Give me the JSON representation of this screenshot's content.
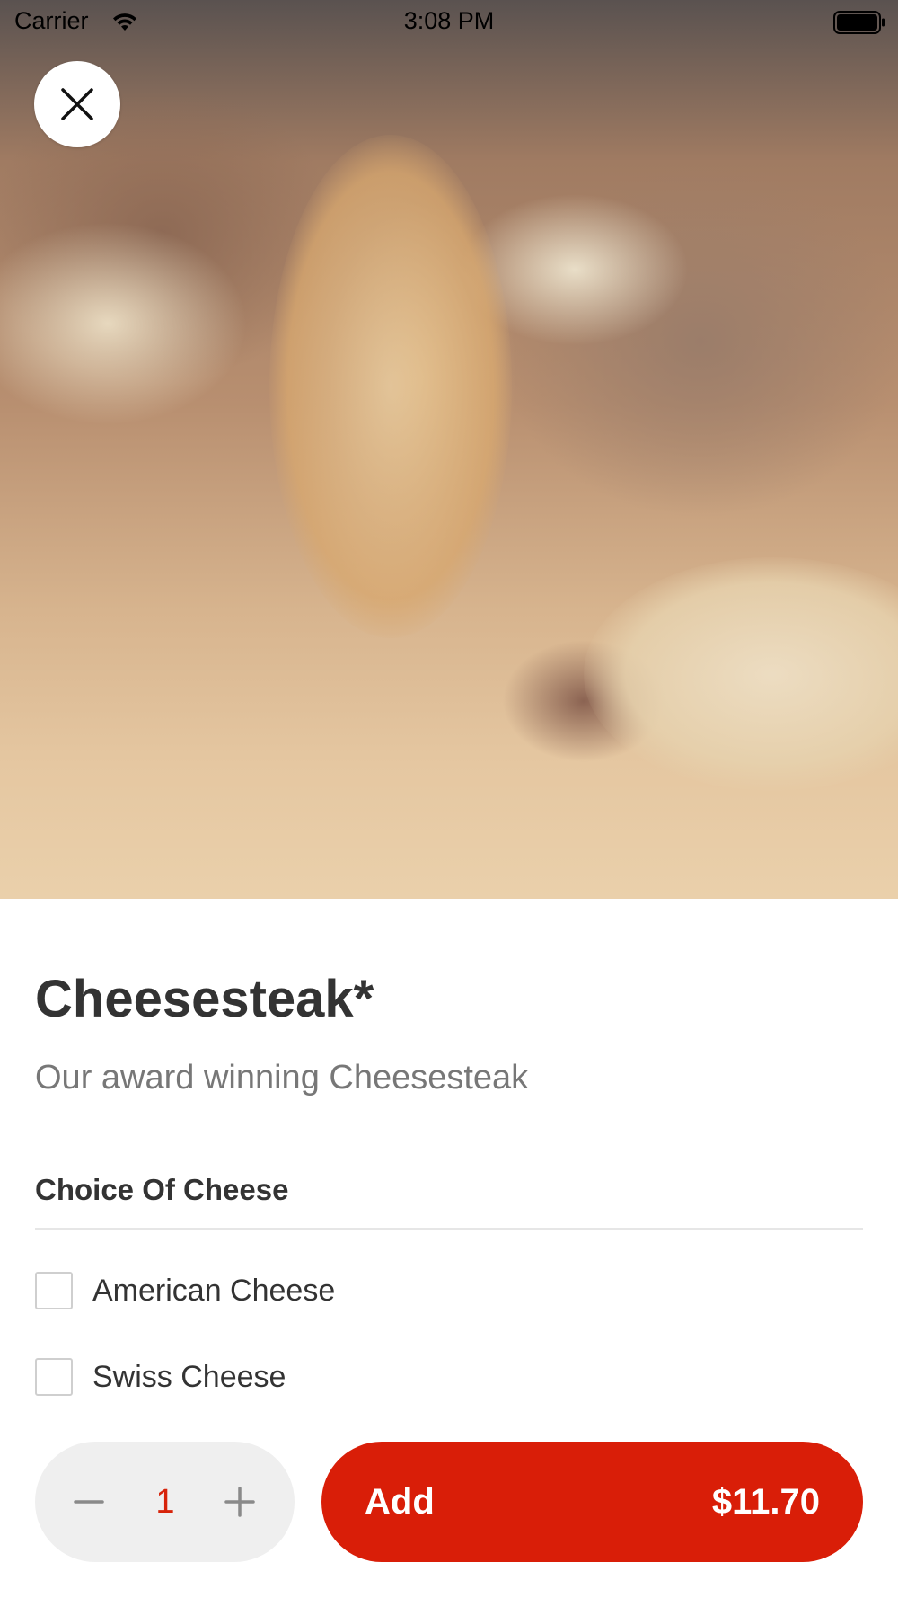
{
  "status_bar": {
    "carrier": "Carrier",
    "time": "3:08 PM"
  },
  "hero": {
    "icon_close": "close-icon"
  },
  "product": {
    "title": "Cheesesteak*",
    "description": "Our award winning Cheesesteak"
  },
  "options": {
    "section_title": "Choice Of Cheese",
    "items": [
      {
        "label": "American Cheese",
        "checked": false
      },
      {
        "label": "Swiss Cheese",
        "checked": false
      }
    ]
  },
  "footer": {
    "quantity": "1",
    "add_label": "Add",
    "price": "$11.70",
    "accent_color": "#d91e08"
  }
}
